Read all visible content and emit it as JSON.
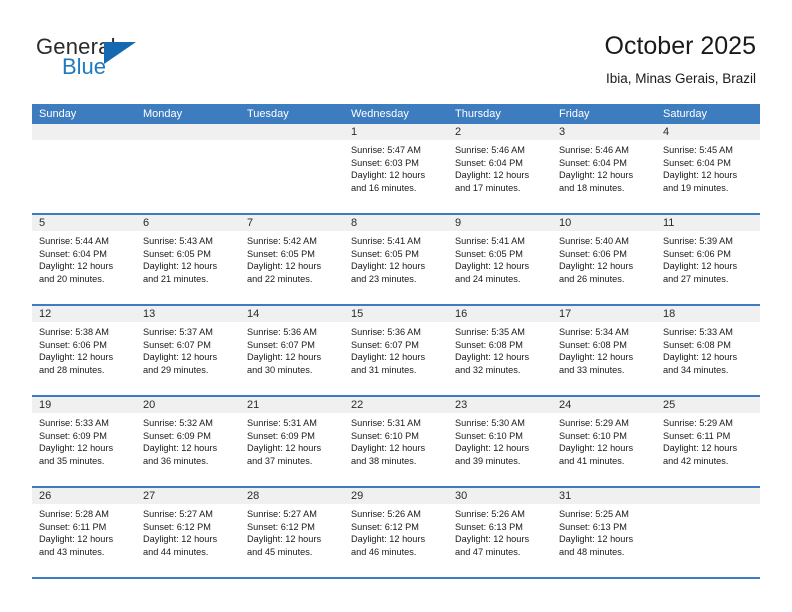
{
  "brand": {
    "name_top": "General",
    "name_bottom": "Blue",
    "triangle_color": "#1569b0",
    "blue_text_color": "#1f7ac0"
  },
  "header": {
    "title": "October 2025",
    "subtitle": "Ibia, Minas Gerais, Brazil"
  },
  "theme": {
    "header_band": "#3c7cbf",
    "daynum_band": "#f0f0f0",
    "cell_background": "#ffffff",
    "text": "#1a1a1a"
  },
  "calendar": {
    "weekday_headers": [
      "Sunday",
      "Monday",
      "Tuesday",
      "Wednesday",
      "Thursday",
      "Friday",
      "Saturday"
    ],
    "labels": {
      "sunrise": "Sunrise:",
      "sunset": "Sunset:",
      "daylight": "Daylight:"
    },
    "weeks": [
      [
        {
          "day": "",
          "empty": true,
          "sunrise": "",
          "sunset": "",
          "daylight_1": "",
          "daylight_2": ""
        },
        {
          "day": "",
          "empty": true,
          "sunrise": "",
          "sunset": "",
          "daylight_1": "",
          "daylight_2": ""
        },
        {
          "day": "",
          "empty": true,
          "sunrise": "",
          "sunset": "",
          "daylight_1": "",
          "daylight_2": ""
        },
        {
          "day": "1",
          "empty": false,
          "sunrise": "Sunrise: 5:47 AM",
          "sunset": "Sunset: 6:03 PM",
          "daylight_1": "Daylight: 12 hours",
          "daylight_2": "and 16 minutes."
        },
        {
          "day": "2",
          "empty": false,
          "sunrise": "Sunrise: 5:46 AM",
          "sunset": "Sunset: 6:04 PM",
          "daylight_1": "Daylight: 12 hours",
          "daylight_2": "and 17 minutes."
        },
        {
          "day": "3",
          "empty": false,
          "sunrise": "Sunrise: 5:46 AM",
          "sunset": "Sunset: 6:04 PM",
          "daylight_1": "Daylight: 12 hours",
          "daylight_2": "and 18 minutes."
        },
        {
          "day": "4",
          "empty": false,
          "sunrise": "Sunrise: 5:45 AM",
          "sunset": "Sunset: 6:04 PM",
          "daylight_1": "Daylight: 12 hours",
          "daylight_2": "and 19 minutes."
        }
      ],
      [
        {
          "day": "5",
          "empty": false,
          "sunrise": "Sunrise: 5:44 AM",
          "sunset": "Sunset: 6:04 PM",
          "daylight_1": "Daylight: 12 hours",
          "daylight_2": "and 20 minutes."
        },
        {
          "day": "6",
          "empty": false,
          "sunrise": "Sunrise: 5:43 AM",
          "sunset": "Sunset: 6:05 PM",
          "daylight_1": "Daylight: 12 hours",
          "daylight_2": "and 21 minutes."
        },
        {
          "day": "7",
          "empty": false,
          "sunrise": "Sunrise: 5:42 AM",
          "sunset": "Sunset: 6:05 PM",
          "daylight_1": "Daylight: 12 hours",
          "daylight_2": "and 22 minutes."
        },
        {
          "day": "8",
          "empty": false,
          "sunrise": "Sunrise: 5:41 AM",
          "sunset": "Sunset: 6:05 PM",
          "daylight_1": "Daylight: 12 hours",
          "daylight_2": "and 23 minutes."
        },
        {
          "day": "9",
          "empty": false,
          "sunrise": "Sunrise: 5:41 AM",
          "sunset": "Sunset: 6:05 PM",
          "daylight_1": "Daylight: 12 hours",
          "daylight_2": "and 24 minutes."
        },
        {
          "day": "10",
          "empty": false,
          "sunrise": "Sunrise: 5:40 AM",
          "sunset": "Sunset: 6:06 PM",
          "daylight_1": "Daylight: 12 hours",
          "daylight_2": "and 26 minutes."
        },
        {
          "day": "11",
          "empty": false,
          "sunrise": "Sunrise: 5:39 AM",
          "sunset": "Sunset: 6:06 PM",
          "daylight_1": "Daylight: 12 hours",
          "daylight_2": "and 27 minutes."
        }
      ],
      [
        {
          "day": "12",
          "empty": false,
          "sunrise": "Sunrise: 5:38 AM",
          "sunset": "Sunset: 6:06 PM",
          "daylight_1": "Daylight: 12 hours",
          "daylight_2": "and 28 minutes."
        },
        {
          "day": "13",
          "empty": false,
          "sunrise": "Sunrise: 5:37 AM",
          "sunset": "Sunset: 6:07 PM",
          "daylight_1": "Daylight: 12 hours",
          "daylight_2": "and 29 minutes."
        },
        {
          "day": "14",
          "empty": false,
          "sunrise": "Sunrise: 5:36 AM",
          "sunset": "Sunset: 6:07 PM",
          "daylight_1": "Daylight: 12 hours",
          "daylight_2": "and 30 minutes."
        },
        {
          "day": "15",
          "empty": false,
          "sunrise": "Sunrise: 5:36 AM",
          "sunset": "Sunset: 6:07 PM",
          "daylight_1": "Daylight: 12 hours",
          "daylight_2": "and 31 minutes."
        },
        {
          "day": "16",
          "empty": false,
          "sunrise": "Sunrise: 5:35 AM",
          "sunset": "Sunset: 6:08 PM",
          "daylight_1": "Daylight: 12 hours",
          "daylight_2": "and 32 minutes."
        },
        {
          "day": "17",
          "empty": false,
          "sunrise": "Sunrise: 5:34 AM",
          "sunset": "Sunset: 6:08 PM",
          "daylight_1": "Daylight: 12 hours",
          "daylight_2": "and 33 minutes."
        },
        {
          "day": "18",
          "empty": false,
          "sunrise": "Sunrise: 5:33 AM",
          "sunset": "Sunset: 6:08 PM",
          "daylight_1": "Daylight: 12 hours",
          "daylight_2": "and 34 minutes."
        }
      ],
      [
        {
          "day": "19",
          "empty": false,
          "sunrise": "Sunrise: 5:33 AM",
          "sunset": "Sunset: 6:09 PM",
          "daylight_1": "Daylight: 12 hours",
          "daylight_2": "and 35 minutes."
        },
        {
          "day": "20",
          "empty": false,
          "sunrise": "Sunrise: 5:32 AM",
          "sunset": "Sunset: 6:09 PM",
          "daylight_1": "Daylight: 12 hours",
          "daylight_2": "and 36 minutes."
        },
        {
          "day": "21",
          "empty": false,
          "sunrise": "Sunrise: 5:31 AM",
          "sunset": "Sunset: 6:09 PM",
          "daylight_1": "Daylight: 12 hours",
          "daylight_2": "and 37 minutes."
        },
        {
          "day": "22",
          "empty": false,
          "sunrise": "Sunrise: 5:31 AM",
          "sunset": "Sunset: 6:10 PM",
          "daylight_1": "Daylight: 12 hours",
          "daylight_2": "and 38 minutes."
        },
        {
          "day": "23",
          "empty": false,
          "sunrise": "Sunrise: 5:30 AM",
          "sunset": "Sunset: 6:10 PM",
          "daylight_1": "Daylight: 12 hours",
          "daylight_2": "and 39 minutes."
        },
        {
          "day": "24",
          "empty": false,
          "sunrise": "Sunrise: 5:29 AM",
          "sunset": "Sunset: 6:10 PM",
          "daylight_1": "Daylight: 12 hours",
          "daylight_2": "and 41 minutes."
        },
        {
          "day": "25",
          "empty": false,
          "sunrise": "Sunrise: 5:29 AM",
          "sunset": "Sunset: 6:11 PM",
          "daylight_1": "Daylight: 12 hours",
          "daylight_2": "and 42 minutes."
        }
      ],
      [
        {
          "day": "26",
          "empty": false,
          "sunrise": "Sunrise: 5:28 AM",
          "sunset": "Sunset: 6:11 PM",
          "daylight_1": "Daylight: 12 hours",
          "daylight_2": "and 43 minutes."
        },
        {
          "day": "27",
          "empty": false,
          "sunrise": "Sunrise: 5:27 AM",
          "sunset": "Sunset: 6:12 PM",
          "daylight_1": "Daylight: 12 hours",
          "daylight_2": "and 44 minutes."
        },
        {
          "day": "28",
          "empty": false,
          "sunrise": "Sunrise: 5:27 AM",
          "sunset": "Sunset: 6:12 PM",
          "daylight_1": "Daylight: 12 hours",
          "daylight_2": "and 45 minutes."
        },
        {
          "day": "29",
          "empty": false,
          "sunrise": "Sunrise: 5:26 AM",
          "sunset": "Sunset: 6:12 PM",
          "daylight_1": "Daylight: 12 hours",
          "daylight_2": "and 46 minutes."
        },
        {
          "day": "30",
          "empty": false,
          "sunrise": "Sunrise: 5:26 AM",
          "sunset": "Sunset: 6:13 PM",
          "daylight_1": "Daylight: 12 hours",
          "daylight_2": "and 47 minutes."
        },
        {
          "day": "31",
          "empty": false,
          "sunrise": "Sunrise: 5:25 AM",
          "sunset": "Sunset: 6:13 PM",
          "daylight_1": "Daylight: 12 hours",
          "daylight_2": "and 48 minutes."
        },
        {
          "day": "",
          "empty": true,
          "sunrise": "",
          "sunset": "",
          "daylight_1": "",
          "daylight_2": ""
        }
      ]
    ]
  }
}
